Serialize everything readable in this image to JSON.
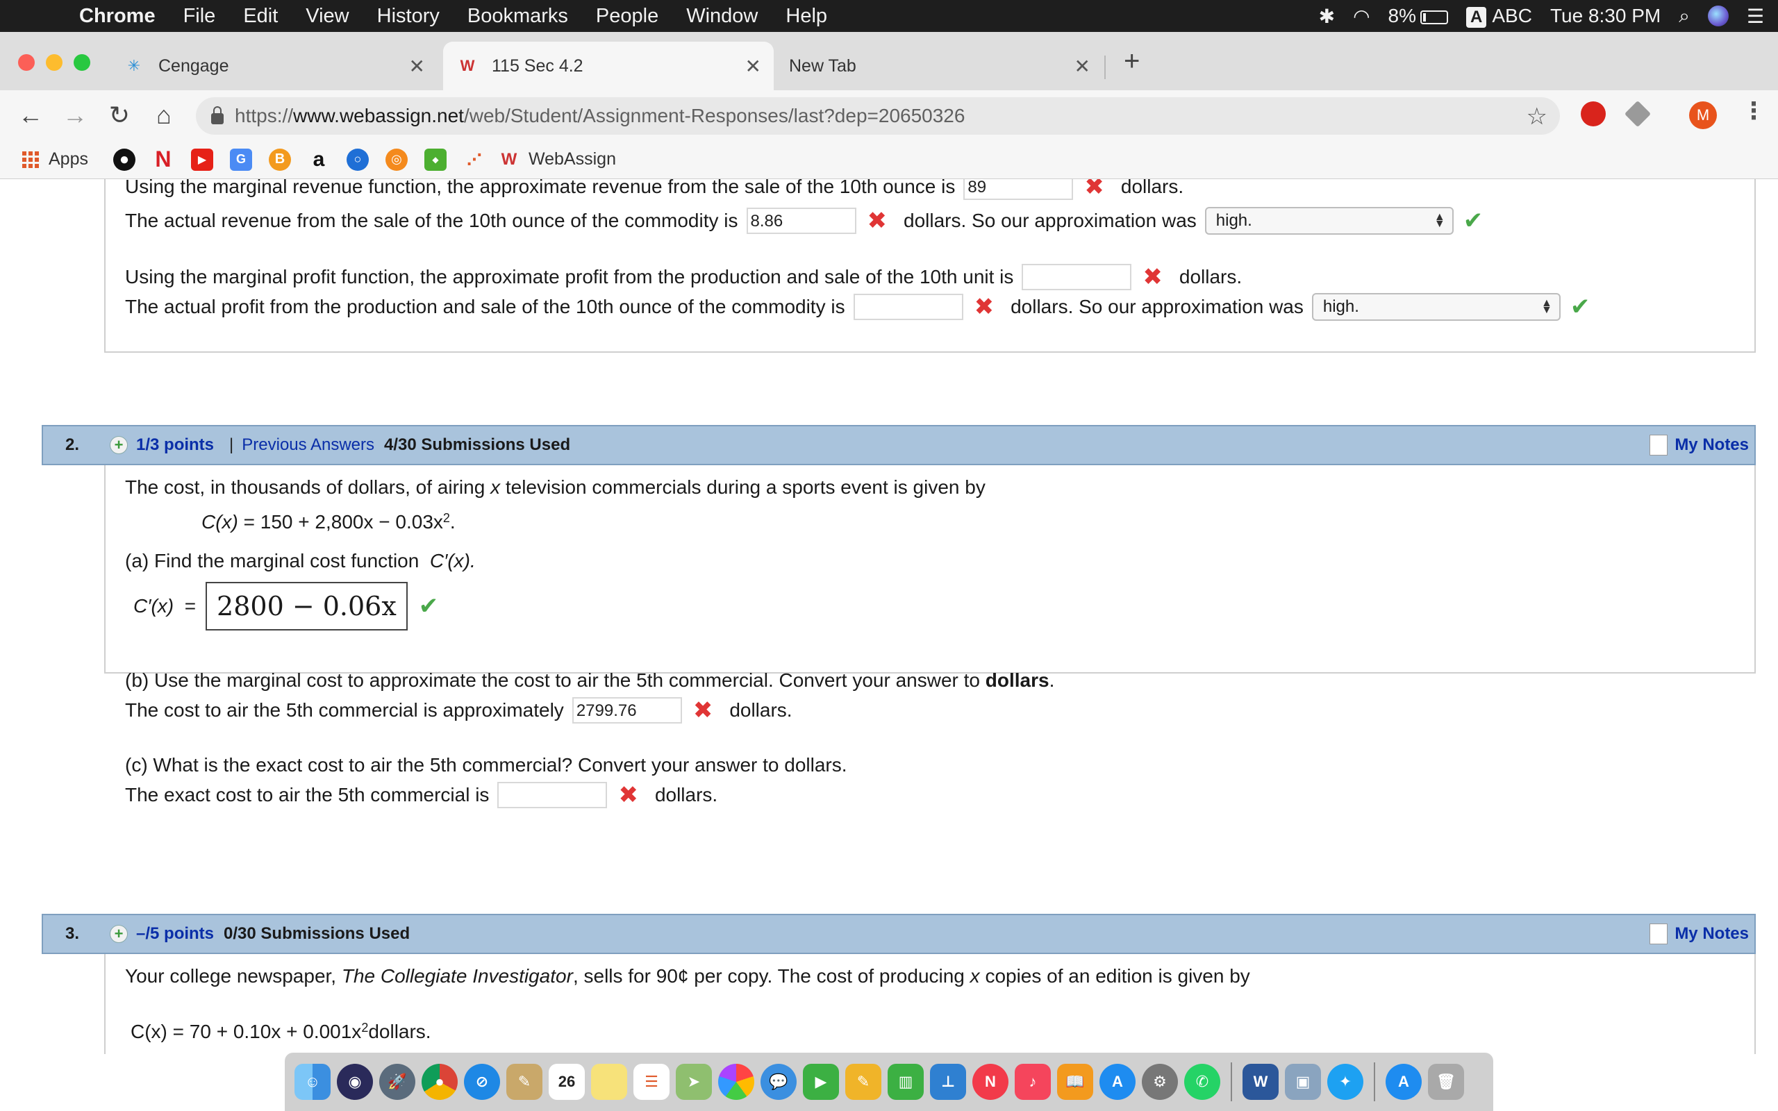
{
  "menubar": {
    "app": "Chrome",
    "items": [
      "File",
      "Edit",
      "View",
      "History",
      "Bookmarks",
      "People",
      "Window",
      "Help"
    ],
    "battery": "8%",
    "input_badge": "A",
    "input_source": "ABC",
    "clock": "Tue 8:30 PM"
  },
  "tabs": [
    {
      "title": "Cengage",
      "favicon": "cengage-icon"
    },
    {
      "title": "115 Sec 4.2",
      "favicon": "webassign-icon",
      "active": true
    },
    {
      "title": "New Tab"
    }
  ],
  "toolbar": {
    "url_scheme": "https://",
    "url_host": "www.webassign.net",
    "url_path": "/web/Student/Assignment-Responses/last?dep=20650326",
    "avatar_letter": "M"
  },
  "bookmarks": {
    "apps_label": "Apps",
    "amazon_glyph": "a",
    "webassign_label": "WebAssign"
  },
  "q1": {
    "rev_approx_text": "Using the marginal revenue function, the approximate revenue from the sale of the 10th ounce is",
    "rev_approx_value": "89",
    "rev_actual_text": "The actual revenue from the sale of the 10th ounce of the commodity is",
    "rev_actual_value": "8.86",
    "profit_approx_text": "Using the marginal profit function, the approximate profit from the production and sale of the 10th unit is",
    "profit_approx_value": "",
    "profit_actual_text": "The actual profit from the production and sale of the 10th ounce of the commodity is",
    "profit_actual_value": "",
    "dollars": "dollars.",
    "approx_was": "dollars. So our approximation was",
    "rev_select": "high.",
    "profit_select": "high."
  },
  "q2": {
    "number": "2.",
    "points": "1/3 points",
    "separator": "|",
    "previous_answers": "Previous Answers",
    "submissions": "4/30 Submissions Used",
    "my_notes": "My Notes",
    "intro_a": "The cost, in thousands of dollars, of airing",
    "intro_var": "x",
    "intro_b": "television commercials during a sports event is given by",
    "formula_lhs": "C(x)",
    "formula_rhs": "= 150 + 2,800x − 0.03x",
    "formula_exp": "2",
    "formula_end": ".",
    "part_a": "(a) Find the marginal cost function",
    "part_a_fn": "C′(x).",
    "answer_label": "C′(x)",
    "answer_eq": "=",
    "answer_value": "2800 − 0.06x",
    "part_b_a": "(b) Use the marginal cost to approximate the cost to air the 5th commercial. Convert your answer to",
    "part_b_bold": "dollars",
    "part_b_end": ".",
    "part_b_line": "The cost to air the 5th commercial is approximately",
    "part_b_value": "2799.76",
    "dollars": "dollars.",
    "part_c": "(c) What is the exact cost to air the 5th commercial? Convert your answer to dollars.",
    "part_c_line": "The exact cost to air the 5th commercial is",
    "part_c_value": ""
  },
  "q3": {
    "number": "3.",
    "points": "–/5 points",
    "submissions": "0/30 Submissions Used",
    "my_notes": "My Notes",
    "intro_a": "Your college newspaper,",
    "intro_title": "The Collegiate Investigator",
    "intro_b": ", sells for 90¢ per copy. The cost of producing",
    "intro_var": "x",
    "intro_c": "copies of an edition is given by",
    "formula": "C(x) = 70 + 0.10x + 0.001x",
    "formula_exp": "2",
    "formula_end": " dollars."
  },
  "dock": {
    "calendar_day": "26",
    "word_glyph": "W"
  },
  "colors": {
    "question_header": "#a9c3dc",
    "link_blue": "#0a2ea8",
    "wrong_red": "#e03535",
    "correct_green": "#4aa84a"
  }
}
